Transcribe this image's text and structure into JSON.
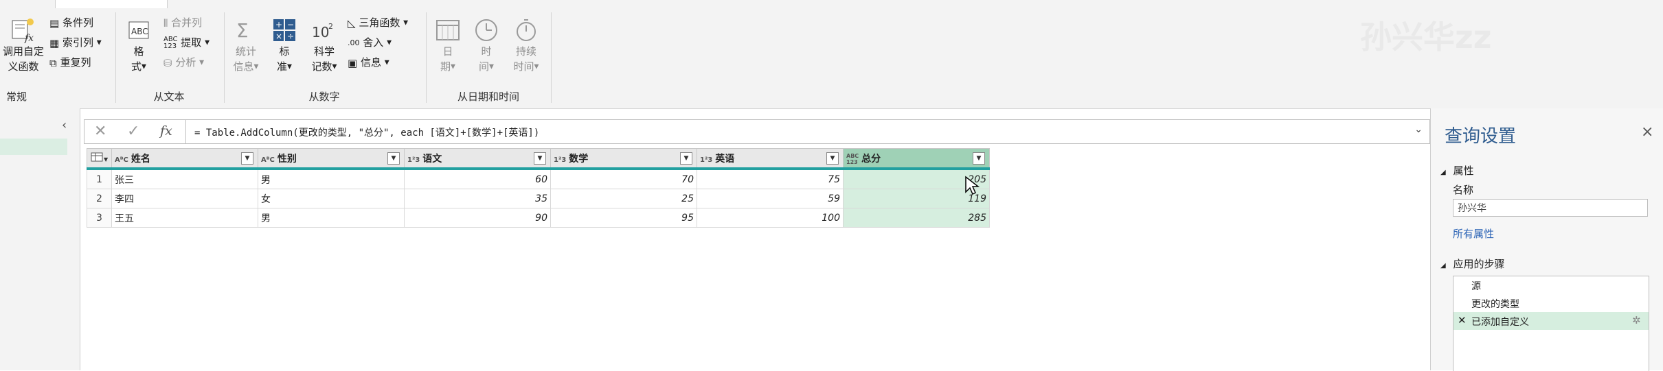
{
  "ribbon": {
    "groups": {
      "general": {
        "label": "常规",
        "invoke_fn_line1": "调用自定",
        "invoke_fn_line2": "义函数",
        "conditional_column": "条件列",
        "index_column": "索引列",
        "duplicate_column": "重复列"
      },
      "from_text": {
        "label": "从文本",
        "format_line1": "格",
        "format_line2": "式",
        "merge_columns": "合并列",
        "extract": "提取",
        "parse": "分析"
      },
      "from_number": {
        "label": "从数字",
        "statistics_line1": "统计",
        "statistics_line2": "信息",
        "standard_line1": "标",
        "standard_line2": "准",
        "scientific_line1": "科学",
        "scientific_line2": "记数",
        "trigonometry": "三角函数",
        "rounding": "舍入",
        "information": "信息"
      },
      "from_datetime": {
        "label": "从日期和时间",
        "date_line1": "日",
        "date_line2": "期",
        "time_line1": "时",
        "time_line2": "间",
        "duration_line1": "持续",
        "duration_line2": "时间"
      }
    },
    "watermark": "孙兴华zz"
  },
  "formula_bar": {
    "text": "= Table.AddColumn(更改的类型, \"总分\", each [语文]+[数学]+[英语])"
  },
  "grid": {
    "columns": [
      {
        "name": "姓名",
        "type": "ABC"
      },
      {
        "name": "性别",
        "type": "ABC"
      },
      {
        "name": "语文",
        "type": "123"
      },
      {
        "name": "数学",
        "type": "123"
      },
      {
        "name": "英语",
        "type": "123"
      },
      {
        "name": "总分",
        "type": "ABC123"
      }
    ],
    "rows": [
      {
        "n": "1",
        "cells": [
          "张三",
          "男",
          "60",
          "70",
          "75",
          "205"
        ]
      },
      {
        "n": "2",
        "cells": [
          "李四",
          "女",
          "35",
          "25",
          "59",
          "119"
        ]
      },
      {
        "n": "3",
        "cells": [
          "王五",
          "男",
          "90",
          "95",
          "100",
          "285"
        ]
      }
    ]
  },
  "query_settings": {
    "title": "查询设置",
    "properties_header": "属性",
    "name_label": "名称",
    "name_value": "孙兴华",
    "all_properties_link": "所有属性",
    "applied_steps_header": "应用的步骤",
    "steps": [
      "源",
      "更改的类型",
      "已添加自定义"
    ]
  },
  "colors": {
    "accent_teal": "#22a0a0",
    "selected_header": "#9fd1b6",
    "selected_cell": "#d6eedf",
    "link_blue": "#2b63b5"
  }
}
